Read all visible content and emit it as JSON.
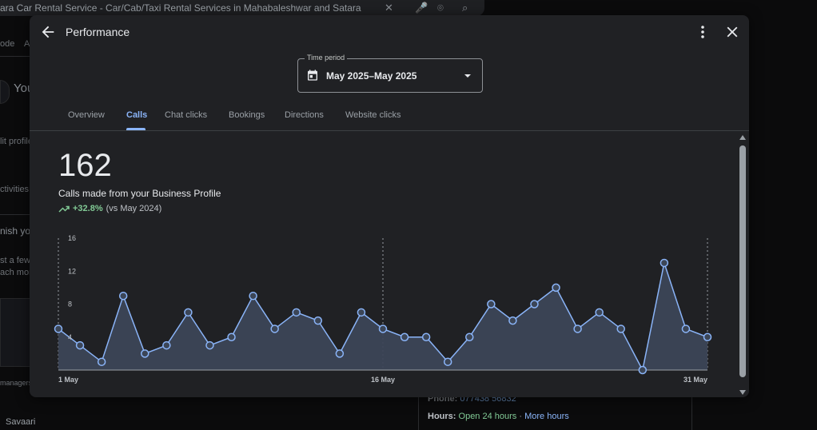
{
  "background": {
    "search_query": "ara Car Rental Service - Car/Cab/Taxi Rental Services in Mahabaleshwar and Satara",
    "left_snippets": [
      "ode",
      "A",
      "You",
      "lit profile",
      "ctivities",
      "nish yo",
      "st a few",
      "ach mor",
      "managers"
    ],
    "bottom_left_text": "Savaari",
    "phone_label": "Phone:",
    "phone_value": "077438 56832",
    "hours_label": "Hours:",
    "hours_status": "Open 24 hours",
    "hours_sep": "·",
    "more_hours": "More hours"
  },
  "modal": {
    "title": "Performance",
    "time_period": {
      "label": "Time period",
      "value": "May 2025–May 2025"
    },
    "tabs": [
      {
        "label": "Overview",
        "active": false
      },
      {
        "label": "Calls",
        "active": true
      },
      {
        "label": "Chat clicks",
        "active": false
      },
      {
        "label": "Bookings",
        "active": false
      },
      {
        "label": "Directions",
        "active": false
      },
      {
        "label": "Website clicks",
        "active": false
      }
    ],
    "metric": {
      "value": "162",
      "description": "Calls made from your Business Profile",
      "change": "+32.8%",
      "comparison": "(vs May 2024)"
    }
  },
  "colors": {
    "accent": "#8ab4f8",
    "positive": "#81c995",
    "area": "#3c4657"
  },
  "chart_data": {
    "type": "area",
    "x": [
      "1 May",
      "2 May",
      "3 May",
      "4 May",
      "5 May",
      "6 May",
      "7 May",
      "8 May",
      "9 May",
      "10 May",
      "11 May",
      "12 May",
      "13 May",
      "14 May",
      "15 May",
      "16 May",
      "17 May",
      "18 May",
      "19 May",
      "20 May",
      "21 May",
      "22 May",
      "23 May",
      "24 May",
      "25 May",
      "26 May",
      "27 May",
      "28 May",
      "29 May",
      "30 May",
      "31 May"
    ],
    "values": [
      5,
      3,
      1,
      9,
      2,
      3,
      7,
      3,
      4,
      9,
      5,
      7,
      6,
      2,
      7,
      5,
      4,
      4,
      1,
      4,
      8,
      6,
      8,
      10,
      5,
      7,
      5,
      0,
      13,
      5,
      4
    ],
    "y_ticks": [
      4,
      8,
      12,
      16
    ],
    "x_tick_labels": [
      "1 May",
      "16 May",
      "31 May"
    ],
    "ylim": [
      0,
      16
    ],
    "grid": false,
    "reference_lines_at": [
      "1 May",
      "16 May",
      "31 May"
    ]
  }
}
